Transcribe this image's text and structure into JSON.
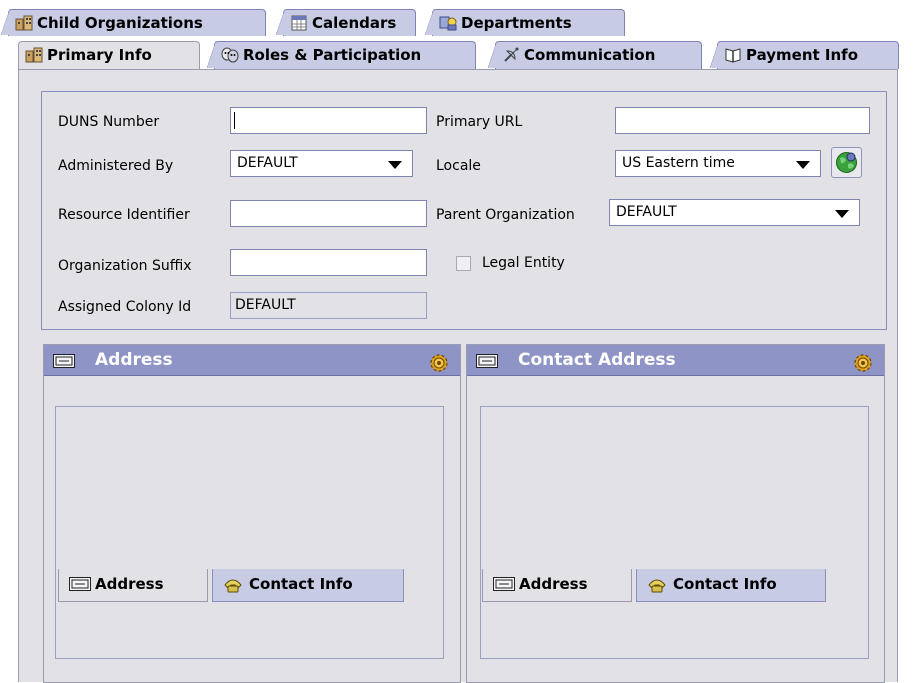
{
  "tabs_back": [
    {
      "label": "Child Organizations",
      "icon": "organization-icon"
    },
    {
      "label": "Calendars",
      "icon": "calendar-icon"
    },
    {
      "label": "Departments",
      "icon": "departments-icon"
    }
  ],
  "tabs_front": [
    {
      "label": "Primary Info",
      "icon": "building-icon",
      "active": true
    },
    {
      "label": "Roles & Participation",
      "icon": "masks-icon"
    },
    {
      "label": "Communication",
      "icon": "satellite-icon"
    },
    {
      "label": "Payment Info",
      "icon": "book-icon"
    }
  ],
  "form": {
    "duns_label": "DUNS Number",
    "duns_value": "",
    "primary_url_label": "Primary URL",
    "primary_url_value": "",
    "administered_by_label": "Administered By",
    "administered_by_value": "DEFAULT",
    "locale_label": "Locale",
    "locale_value": "US Eastern time",
    "resource_identifier_label": "Resource Identifier",
    "resource_identifier_value": "",
    "parent_org_label": "Parent Organization",
    "parent_org_value": "DEFAULT",
    "org_suffix_label": "Organization Suffix",
    "org_suffix_value": "",
    "legal_entity_label": "Legal Entity",
    "legal_entity_checked": false,
    "colony_label": "Assigned Colony Id",
    "colony_value": "DEFAULT"
  },
  "panels": {
    "address": {
      "title": "Address",
      "tabs": [
        {
          "label": "Address",
          "icon": "address-card-icon",
          "active": true
        },
        {
          "label": "Contact Info",
          "icon": "phone-icon"
        }
      ]
    },
    "contact_address": {
      "title": "Contact Address",
      "tabs": [
        {
          "label": "Address",
          "icon": "address-card-icon",
          "active": true
        },
        {
          "label": "Contact Info",
          "icon": "phone-icon"
        }
      ]
    }
  },
  "colors": {
    "tab_bg": "#c7cbe4",
    "panel_bg": "#e2e2e6",
    "panel_header": "#8f94c6",
    "border": "#7f84b0"
  }
}
